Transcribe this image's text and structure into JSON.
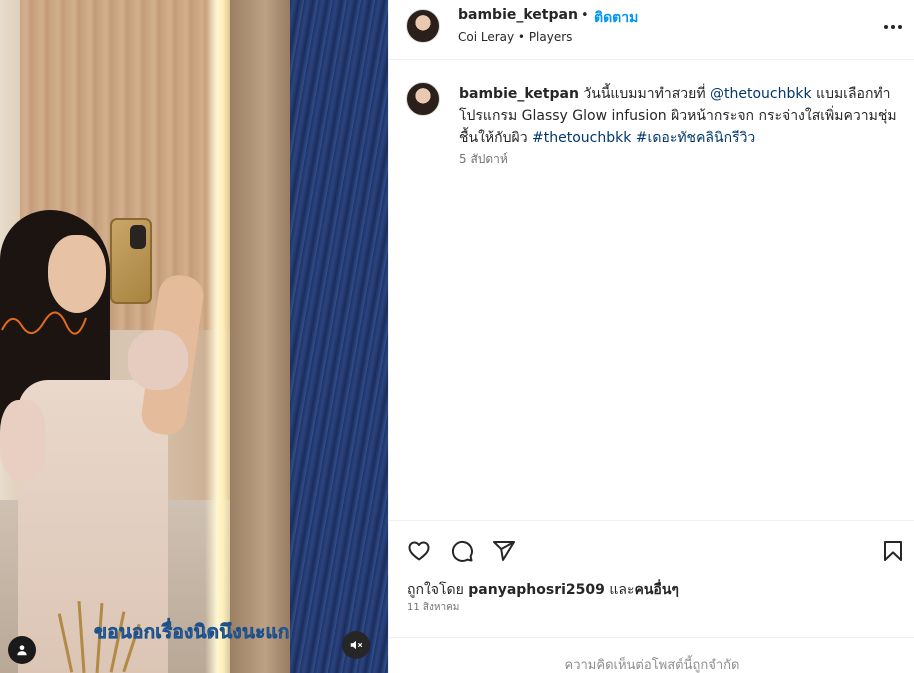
{
  "media": {
    "subtitle": "ขอนอกเรื่องนิดนึงนะแก"
  },
  "header": {
    "username": "bambie_ketpan",
    "separator": "•",
    "follow_label": "ติดตาม",
    "audio": "Coi Leray • Players"
  },
  "caption": {
    "username": "bambie_ketpan",
    "text_1": "วันนี้แบมมาทำสวยที่",
    "mention": "@thetouchbkk",
    "text_2": "แบมเลือกทำโปรแกรม Glassy Glow infusion ผิวหน้ากระจก กระจ่างใสเพิ่มความชุ่มชื้นให้กับผิว",
    "hashtag_1": "#thetouchbkk",
    "hashtag_2": "#เดอะทัชคลินิกรีวิว",
    "time": "5 สัปดาห์"
  },
  "likes": {
    "prefix": "ถูกใจโดย",
    "user": "panyaphosri2509",
    "connector": "และ",
    "others": "คนอื่นๆ"
  },
  "post_date": "11 สิงหาคม",
  "comments_limited": "ความคิดเห็นต่อโพสต์นี้ถูกจำกัด",
  "icons": {
    "like": "heart-icon",
    "comment": "comment-icon",
    "share": "share-icon",
    "save": "bookmark-icon",
    "more": "more-icon",
    "tag": "user-tag-icon",
    "mute": "muted-speaker-icon"
  }
}
